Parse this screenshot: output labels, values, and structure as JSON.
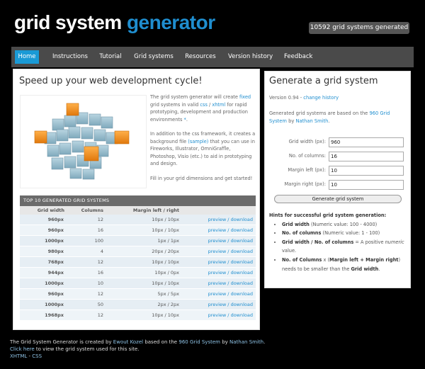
{
  "header": {
    "logo_part1": "grid system",
    "logo_part2": "generator",
    "counter": "10592 grid systems generated"
  },
  "nav": {
    "items": [
      "Home",
      "Instructions",
      "Tutorial",
      "Grid systems",
      "Resources",
      "Version history",
      "Feedback"
    ],
    "active": "Home"
  },
  "intro": {
    "heading": "Speed up your web development cycle!",
    "p1_a": "The grid system generator will create",
    "p1_link1": "fixed",
    "p1_b": "grid systems in valid",
    "p1_link2": "css",
    "p1_sep": "/",
    "p1_link3": "xhtml",
    "p1_c": "for rapid prototyping, development and production environments",
    "p1_link4": "*",
    "p1_end": ".",
    "p2_a": "In addition to the css framework, it creates a background file",
    "p2_link": "(sample)",
    "p2_b": "that you can use in Fireworks, Illustrator, OmniGraffle, Photoshop, Visio (etc.) to aid in prototyping and design.",
    "p3": "Fill in your grid dimensions and get started!"
  },
  "top10": {
    "caption": "TOP 10 GENERATED GRID SYSTEMS",
    "columns": [
      "Grid width",
      "Columns",
      "Margin left / right"
    ],
    "link_preview": "preview",
    "link_sep": "/",
    "link_download": "download",
    "rows": [
      [
        "960px",
        "12",
        "10px / 10px"
      ],
      [
        "960px",
        "16",
        "10px / 10px"
      ],
      [
        "1000px",
        "100",
        "1px / 1px"
      ],
      [
        "980px",
        "4",
        "20px / 20px"
      ],
      [
        "768px",
        "12",
        "10px / 10px"
      ],
      [
        "944px",
        "16",
        "10px / 0px"
      ],
      [
        "1000px",
        "10",
        "10px / 10px"
      ],
      [
        "960px",
        "12",
        "5px / 5px"
      ],
      [
        "1000px",
        "50",
        "2px / 2px"
      ],
      [
        "1968px",
        "12",
        "10px / 10px"
      ]
    ]
  },
  "generate": {
    "heading": "Generate a grid system",
    "version_text": "Version 0.94 -",
    "version_link": "change history",
    "based_a": "Generated grid systems are based on the",
    "based_link1": "960 Grid System",
    "based_b": "by",
    "based_link2": "Nathan Smith",
    "based_end": ".",
    "fields": [
      {
        "label": "Grid width (px):",
        "value": "960"
      },
      {
        "label": "No. of columns:",
        "value": "16"
      },
      {
        "label": "Margin left (px):",
        "value": "10"
      },
      {
        "label": "Margin right (px):",
        "value": "10"
      }
    ],
    "button": "Generate grid system",
    "hints_title": "Hints for successful grid system generation:",
    "hints": [
      {
        "bold": "Grid width",
        "rest": "(Numeric value: 100 - 4000)"
      },
      {
        "bold": "No. of columns",
        "rest": "(Numeric value: 1 - 100)"
      },
      {
        "bold": "Grid width / No. of columns",
        "rest": "= A positive",
        "italic": "numeric",
        "tail": "value."
      },
      {
        "bold": "No. of Columns",
        "rest": "x (",
        "bold2": "Margin left + Margin right",
        "rest2": ") needs to be smaller than the",
        "bold3": "Grid width",
        "tail": "."
      }
    ]
  },
  "footer": {
    "l1_a": "The Grid System Generator is created by",
    "l1_link1": "Ewout Kozel",
    "l1_b": "based on the",
    "l1_link2": "960 Grid System",
    "l1_c": "by",
    "l1_link3": "Nathan Smith",
    "l1_end": ".",
    "l2_link": "Click here",
    "l2_rest": "to view the grid system used for this site.",
    "l3_link1": "XHTML",
    "l3_sep": "-",
    "l3_link2": "CSS"
  },
  "colors": {
    "accent": "#1f8ecf",
    "nav_bg": "#4a4a4a",
    "nav_active": "#1a9ad6",
    "cube_blue": "#8fb8c9",
    "cube_orange": "#f39321"
  }
}
